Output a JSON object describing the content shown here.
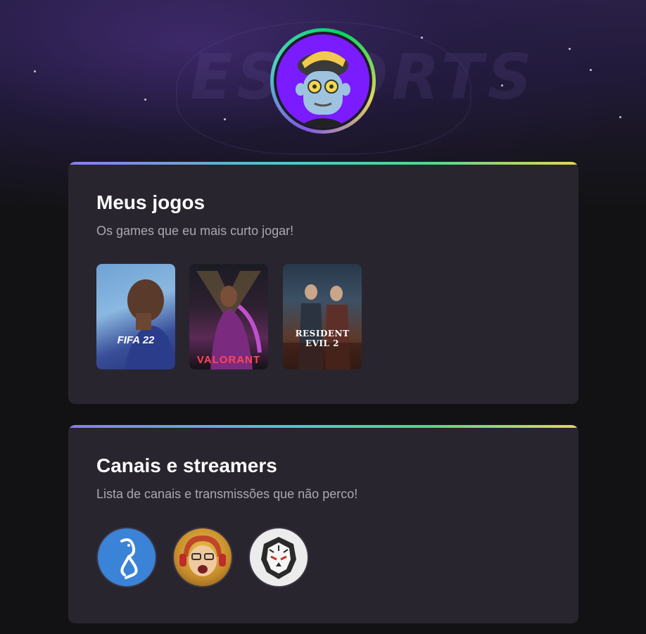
{
  "hero": {
    "emblem_text": "ESPORTS"
  },
  "profile": {
    "avatar_alt": "avatar"
  },
  "games_section": {
    "title": "Meus jogos",
    "subtitle": "Os games que eu mais curto jogar!",
    "games": [
      {
        "label": "FIFA 22"
      },
      {
        "label": "VALORANT"
      },
      {
        "label": "RESIDENT EVIL 2"
      }
    ]
  },
  "channels_section": {
    "title": "Canais e streamers",
    "subtitle": "Lista de canais e transmissões que não perco!"
  },
  "colors": {
    "background": "#121214",
    "card": "#29252f",
    "accent_purple": "#8257e5",
    "accent_green": "#04d361",
    "accent_yellow": "#e1d55d"
  }
}
